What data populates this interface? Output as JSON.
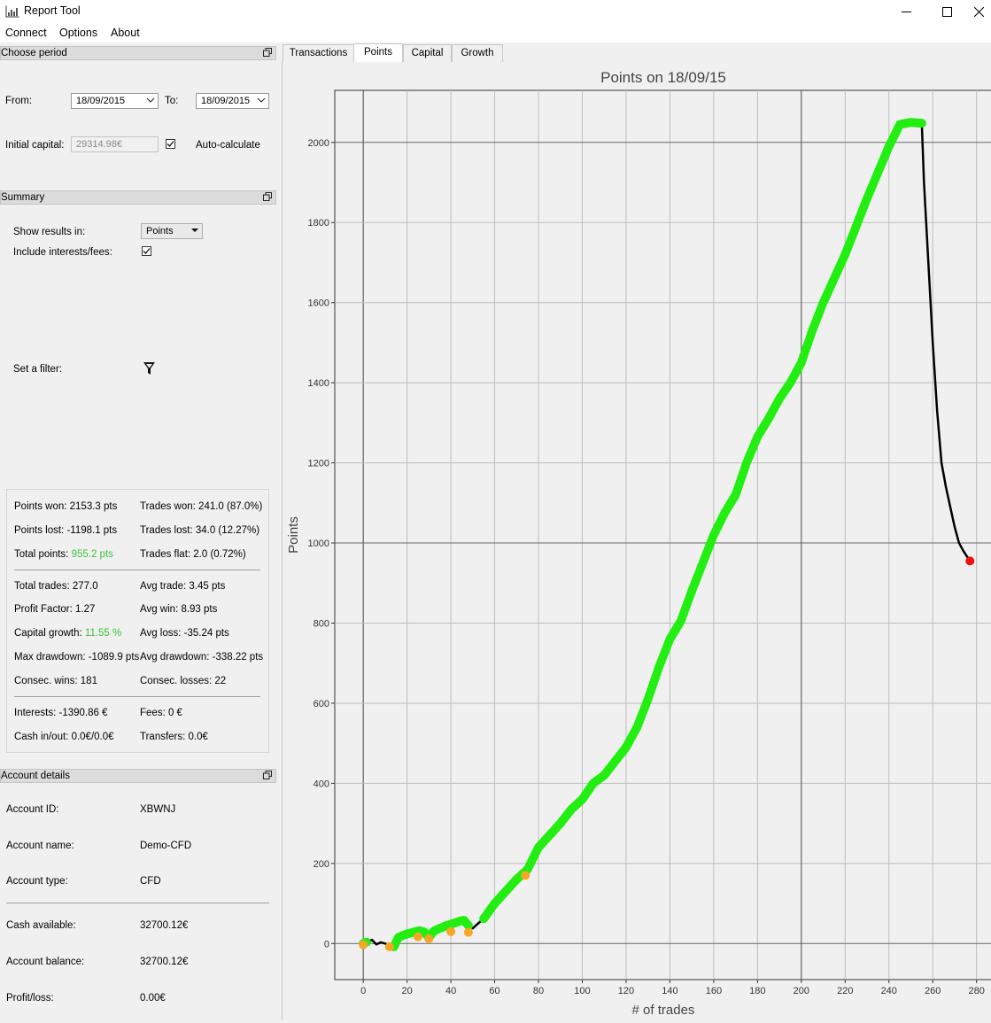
{
  "window": {
    "title": "Report Tool"
  },
  "menu": {
    "items": [
      "Connect",
      "Options",
      "About"
    ]
  },
  "period": {
    "header": "Choose period",
    "from_label": "From:",
    "from_value": "18/09/2015",
    "to_label": "To:",
    "to_value": "18/09/2015",
    "capital_label": "Initial capital:",
    "capital_value": "29314.98€",
    "autocalc_label": "Auto-calculate",
    "autocalc_checked": true
  },
  "summary": {
    "header": "Summary",
    "show_results_label": "Show results in:",
    "show_results_value": "Points",
    "include_label": "Include interests/fees:",
    "include_checked": true,
    "filter_label": "Set a filter:",
    "stats": {
      "points_won": "Points won: 2153.3 pts",
      "trades_won": "Trades won: 241.0 (87.0%)",
      "points_lost": "Points lost: -1198.1 pts",
      "trades_lost": "Trades lost: 34.0 (12.27%)",
      "total_points_label": "Total points: ",
      "total_points_value": "955.2 pts",
      "trades_flat": "Trades flat: 2.0 (0.72%)",
      "total_trades": "Total trades: 277.0",
      "avg_trade": "Avg trade: 3.45 pts",
      "profit_factor": "Profit Factor: 1.27",
      "avg_win": "Avg win: 8.93 pts",
      "capital_growth_label": "Capital growth: ",
      "capital_growth_value": "11.55 %",
      "avg_loss": "Avg loss: -35.24 pts",
      "max_drawdown": "Max drawdown: -1089.9 pts",
      "avg_drawdown": "Avg drawdown: -338.22 pts",
      "consec_wins": "Consec. wins: 181",
      "consec_losses": "Consec. losses: 22",
      "interests": "Interests: -1390.86 €",
      "fees": "Fees: 0 €",
      "cash_inout": "Cash in/out: 0.0€/0.0€",
      "transfers": "Transfers: 0.0€"
    }
  },
  "account": {
    "header": "Account details",
    "id_label": "Account ID:",
    "id_value": "XBWNJ",
    "name_label": "Account name:",
    "name_value": "Demo-CFD",
    "type_label": "Account type:",
    "type_value": "CFD",
    "cash_label": "Cash available:",
    "cash_value": "32700.12€",
    "balance_label": "Account balance:",
    "balance_value": "32700.12€",
    "pl_label": "Profit/loss:",
    "pl_value": "0.00€"
  },
  "tabs": [
    "Transactions",
    "Points",
    "Capital",
    "Growth"
  ],
  "active_tab": "Points",
  "colors": {
    "win": "#22ee11",
    "flat": "#f5a623",
    "last": "#ee1111",
    "line": "#000000"
  },
  "chart_data": {
    "type": "line",
    "title": "Points on 18/09/15",
    "xlabel": "# of trades",
    "ylabel": "Points",
    "xlim": [
      -13,
      287
    ],
    "ylim": [
      -90,
      2130
    ],
    "xticks": [
      0,
      20,
      40,
      60,
      80,
      100,
      120,
      140,
      160,
      180,
      200,
      220,
      240,
      260,
      280
    ],
    "yticks": [
      0,
      200,
      400,
      600,
      800,
      1000,
      1200,
      1400,
      1600,
      1800,
      2000
    ],
    "grid": true,
    "series": [
      {
        "x": [
          0,
          2,
          4,
          6,
          8,
          10,
          12,
          14,
          16,
          18,
          20,
          22,
          24,
          26,
          28,
          30,
          32,
          34,
          36,
          38,
          40,
          42,
          44,
          46,
          48,
          50,
          52,
          55,
          60,
          65,
          70,
          75,
          80,
          85,
          90,
          95,
          100,
          105,
          110,
          115,
          120,
          125,
          130,
          135,
          140,
          145,
          150,
          155,
          160,
          165,
          170,
          175,
          180,
          185,
          190,
          195,
          200,
          205,
          210,
          215,
          220,
          225,
          230,
          235,
          240,
          245,
          250,
          255,
          256,
          258,
          260,
          262,
          264,
          266,
          268,
          270,
          272,
          274,
          277
        ],
        "y": [
          0,
          5,
          9,
          -2,
          3,
          0,
          -6,
          -8,
          15,
          20,
          24,
          27,
          30,
          32,
          28,
          15,
          30,
          36,
          40,
          45,
          48,
          52,
          56,
          58,
          45,
          38,
          48,
          62,
          100,
          130,
          160,
          185,
          240,
          270,
          300,
          335,
          360,
          400,
          420,
          455,
          490,
          540,
          610,
          690,
          760,
          805,
          880,
          950,
          1020,
          1075,
          1120,
          1200,
          1265,
          1310,
          1360,
          1400,
          1450,
          1530,
          1600,
          1660,
          1720,
          1790,
          1860,
          1925,
          1990,
          2045,
          2050,
          2048,
          1900,
          1700,
          1500,
          1330,
          1200,
          1140,
          1090,
          1040,
          1000,
          980,
          955
        ]
      }
    ],
    "flat_points": [
      [
        0,
        -3
      ],
      [
        12,
        -8
      ],
      [
        25,
        17
      ],
      [
        30,
        12
      ],
      [
        40,
        30
      ],
      [
        48,
        28
      ],
      [
        74,
        170
      ]
    ],
    "loss_ranges": [
      [
        -2,
        14
      ],
      [
        48,
        55
      ],
      [
        255,
        277
      ]
    ],
    "last_point": [
      277,
      955
    ]
  }
}
